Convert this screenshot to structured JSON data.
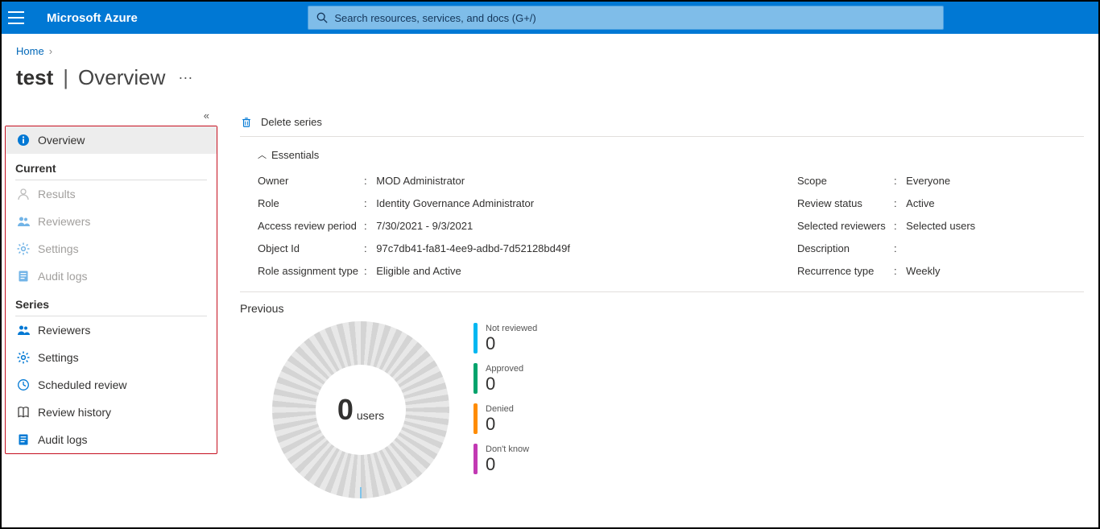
{
  "header": {
    "brand": "Microsoft Azure",
    "search_placeholder": "Search resources, services, and docs (G+/)"
  },
  "breadcrumb": {
    "home": "Home"
  },
  "title": {
    "main": "test",
    "sub": "Overview",
    "more": "···"
  },
  "sidebar": {
    "collapse_glyph": "«",
    "overview": "Overview",
    "current_title": "Current",
    "current_items": [
      "Results",
      "Reviewers",
      "Settings",
      "Audit logs"
    ],
    "series_title": "Series",
    "series_items": [
      "Reviewers",
      "Settings",
      "Scheduled review",
      "Review history",
      "Audit logs"
    ]
  },
  "cmdbar": {
    "delete": "Delete series"
  },
  "essentials": {
    "title": "Essentials",
    "left": {
      "owner_k": "Owner",
      "owner_v": "MOD Administrator",
      "role_k": "Role",
      "role_v": "Identity Governance Administrator",
      "period_k": "Access review period",
      "period_v": "7/30/2021 - 9/3/2021",
      "obj_k": "Object Id",
      "obj_v": "97c7db41-fa81-4ee9-adbd-7d52128bd49f",
      "rat_k": "Role assignment type",
      "rat_v": "Eligible and Active"
    },
    "right": {
      "scope_k": "Scope",
      "scope_v": "Everyone",
      "status_k": "Review status",
      "status_v": "Active",
      "sel_k": "Selected reviewers",
      "sel_v": "Selected users",
      "desc_k": "Description",
      "desc_v": "",
      "rec_k": "Recurrence type",
      "rec_v": "Weekly"
    }
  },
  "previous": {
    "title": "Previous",
    "big": "0",
    "unit": "users",
    "legend": {
      "notrev_lbl": "Not reviewed",
      "notrev_val": "0",
      "appr_lbl": "Approved",
      "appr_val": "0",
      "den_lbl": "Denied",
      "den_val": "0",
      "dk_lbl": "Don't know",
      "dk_val": "0"
    }
  },
  "chart_data": {
    "type": "pie",
    "title": "Previous",
    "unit": "users",
    "total": 0,
    "series": [
      {
        "name": "Not reviewed",
        "value": 0,
        "color": "#00b7f1"
      },
      {
        "name": "Approved",
        "value": 0,
        "color": "#00a36c"
      },
      {
        "name": "Denied",
        "value": 0,
        "color": "#ff8c00"
      },
      {
        "name": "Don't know",
        "value": 0,
        "color": "#c239b3"
      }
    ]
  }
}
